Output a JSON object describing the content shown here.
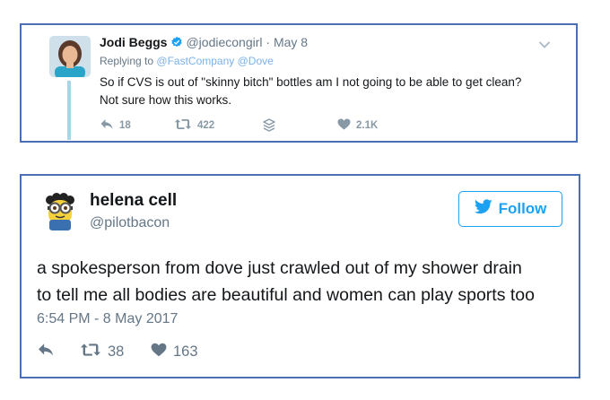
{
  "tweet1": {
    "name": "Jodi Beggs",
    "handle": "@jodiecongirl",
    "separator": "·",
    "date": "May 8",
    "replying_prefix": "Replying to",
    "replying_to": [
      "@FastCompany",
      "@Dove"
    ],
    "text_line1": "So if CVS is out of \"skinny bitch\" bottles am I not going to be able to get clean?",
    "text_line2": "Not sure how this works.",
    "reply_count": "18",
    "retweet_count": "422",
    "like_count": "2.1K",
    "icons": [
      "reply-icon",
      "retweet-icon",
      "stack-icon",
      "heart-icon",
      "verified-badge-icon",
      "chevron-down-icon"
    ]
  },
  "tweet2": {
    "name": "helena cell",
    "handle": "@pilotbacon",
    "follow_label": "Follow",
    "text_line1": "a spokesperson from dove just crawled out of my shower drain",
    "text_line2": "to tell me all bodies are beautiful and women can play sports too",
    "timestamp": "6:54 PM - 8 May 2017",
    "retweet_count": "38",
    "like_count": "163",
    "icons": [
      "reply-icon",
      "retweet-icon",
      "heart-icon",
      "twitter-bird-icon"
    ]
  },
  "colors": {
    "frame_border": "#4a6fb5",
    "twitter_blue": "#1da1f2",
    "muted_text": "#657786",
    "action_gray": "#8899a6",
    "thread_line": "#a9d6e6"
  }
}
